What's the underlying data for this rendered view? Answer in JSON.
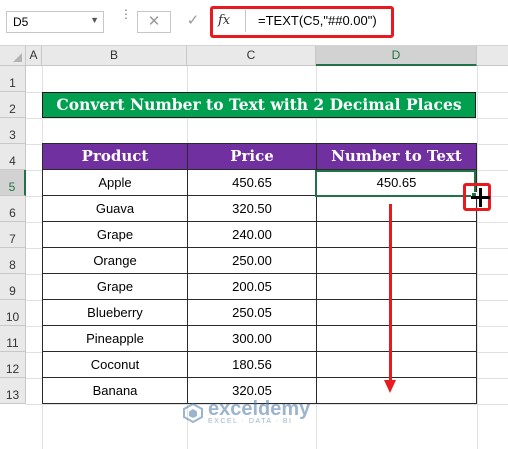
{
  "formula_bar": {
    "name_box": "D5",
    "cancel_glyph": "✕",
    "enter_glyph": "✓",
    "fx_label": "fx",
    "formula": "=TEXT(C5,\"##0.00\")"
  },
  "columns": [
    "A",
    "B",
    "C",
    "D"
  ],
  "rows": [
    "1",
    "2",
    "3",
    "4",
    "5",
    "6",
    "7",
    "8",
    "9",
    "10",
    "11",
    "12",
    "13"
  ],
  "selected_cell": {
    "column": "D",
    "row": "5"
  },
  "sheet": {
    "title": "Convert Number to Text with 2 Decimal Places",
    "headers": [
      "Product",
      "Price",
      "Number to Text"
    ],
    "data": [
      {
        "product": "Apple",
        "price": "450.65",
        "text": "450.65"
      },
      {
        "product": "Guava",
        "price": "320.50",
        "text": ""
      },
      {
        "product": "Grape",
        "price": "240.00",
        "text": ""
      },
      {
        "product": "Orange",
        "price": "250.00",
        "text": ""
      },
      {
        "product": "Grape",
        "price": "200.05",
        "text": ""
      },
      {
        "product": "Blueberry",
        "price": "250.05",
        "text": ""
      },
      {
        "product": "Pineapple",
        "price": "300.00",
        "text": ""
      },
      {
        "product": "Coconut",
        "price": "180.56",
        "text": ""
      },
      {
        "product": "Banana",
        "price": "320.05",
        "text": ""
      }
    ]
  },
  "watermark": {
    "name": "exceldemy",
    "tagline": "EXCEL · DATA · BI"
  },
  "colors": {
    "title_bg": "#00a050",
    "header_bg": "#7030a0",
    "selection": "#217346",
    "highlight": "#e8191f"
  },
  "icons": [
    "cancel-icon",
    "enter-icon",
    "function-icon",
    "fill-handle-cursor-icon",
    "drag-arrow-icon"
  ]
}
